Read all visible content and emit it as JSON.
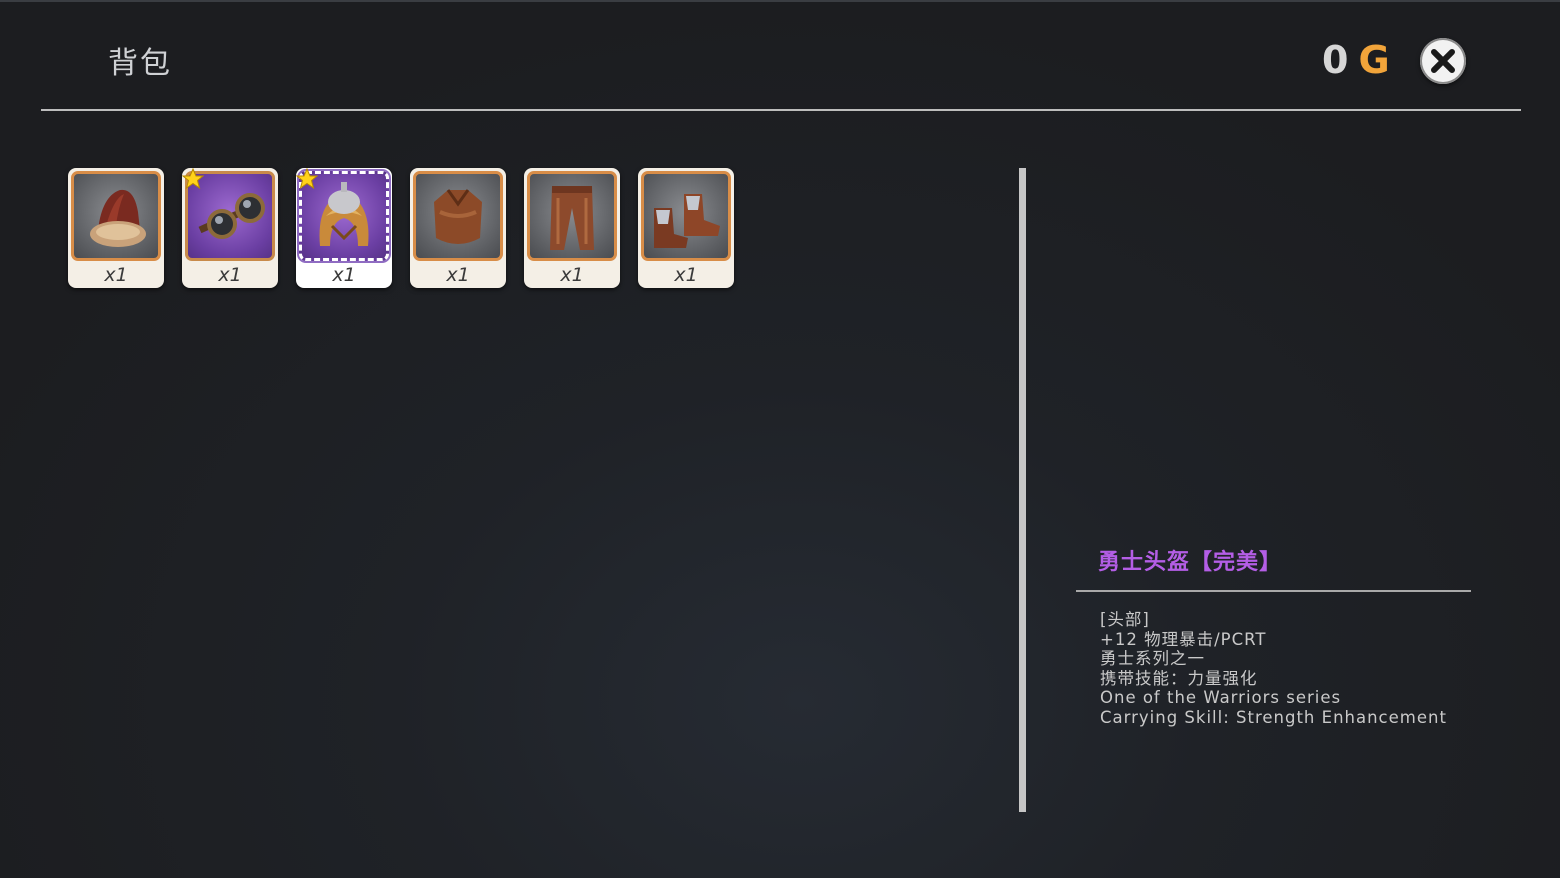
{
  "header": {
    "title": "背包",
    "gold_amount": "0",
    "gold_unit": "G"
  },
  "items": [
    {
      "icon": "fur-hat-icon",
      "qty": "x1",
      "rarity": "normal",
      "starred": false
    },
    {
      "icon": "goggles-icon",
      "qty": "x1",
      "rarity": "epic",
      "starred": true
    },
    {
      "icon": "warrior-helmet-icon",
      "qty": "x1",
      "rarity": "epic",
      "starred": true,
      "selected": true
    },
    {
      "icon": "leather-armor-icon",
      "qty": "x1",
      "rarity": "normal",
      "starred": false
    },
    {
      "icon": "leather-pants-icon",
      "qty": "x1",
      "rarity": "normal",
      "starred": false
    },
    {
      "icon": "leather-boots-icon",
      "qty": "x1",
      "rarity": "normal",
      "starred": false
    }
  ],
  "detail": {
    "name": "勇士头盔【完美】",
    "lines": [
      "[头部]",
      "+12 物理暴击/PCRT",
      "勇士系列之一",
      "携带技能：力量强化",
      "One of the Warriors series",
      "Carrying Skill: Strength Enhancement"
    ]
  },
  "colors": {
    "gold_unit": "#f1a43a",
    "item_name_epic": "#b45ee6",
    "slot_border": "#d88d48",
    "epic_background": "#6b3fa3"
  }
}
